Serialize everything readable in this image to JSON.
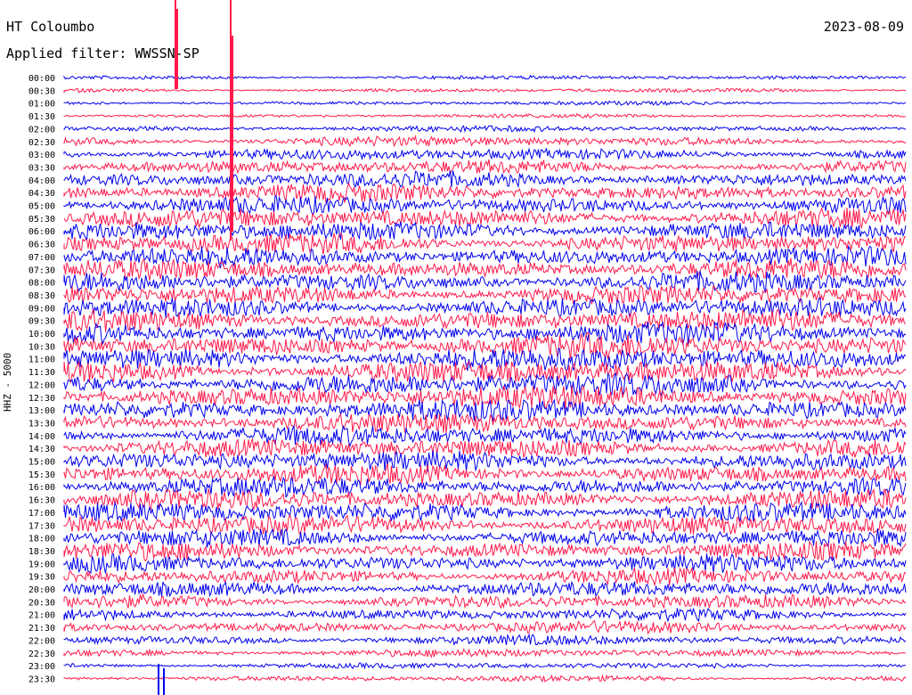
{
  "header": {
    "station": "HT Coloumbo",
    "date": "2023-08-09",
    "filter": "Applied filter: WWSSN-SP"
  },
  "chart_data": {
    "type": "line",
    "title": "HT Coloumbo",
    "ylabel": "HHZ - 5000",
    "row_labels": [
      "00:00",
      "00:30",
      "01:00",
      "01:30",
      "02:00",
      "02:30",
      "03:00",
      "03:30",
      "04:00",
      "04:30",
      "05:00",
      "05:30",
      "06:00",
      "06:30",
      "07:00",
      "07:30",
      "08:00",
      "08:30",
      "09:00",
      "09:30",
      "10:00",
      "10:30",
      "11:00",
      "11:30",
      "12:00",
      "12:30",
      "13:00",
      "13:30",
      "14:00",
      "14:30",
      "15:00",
      "15:30",
      "16:00",
      "16:30",
      "17:00",
      "17:30",
      "18:00",
      "18:30",
      "19:00",
      "19:30",
      "20:00",
      "20:30",
      "21:00",
      "21:30",
      "22:00",
      "22:30",
      "23:00",
      "23:30"
    ],
    "row_amplitude": [
      2,
      2,
      2,
      2,
      3,
      5,
      6,
      7,
      8,
      9,
      9,
      10,
      10,
      10,
      10,
      10,
      10,
      10,
      10,
      11,
      11,
      12,
      12,
      12,
      12,
      12,
      11,
      10,
      10,
      10,
      10,
      10,
      10,
      10,
      10,
      10,
      9,
      9,
      9,
      8,
      8,
      7,
      6,
      6,
      5,
      4,
      3,
      3
    ],
    "series_colors": [
      "#0000ee",
      "#ff1a4b"
    ],
    "events": [
      {
        "time": "00:00",
        "minute": 9,
        "note": "large spike"
      },
      {
        "time": "00:00",
        "minute": 13,
        "note": "large spike"
      },
      {
        "time": "23:30",
        "minute": 8,
        "note": "downward burst"
      }
    ]
  }
}
